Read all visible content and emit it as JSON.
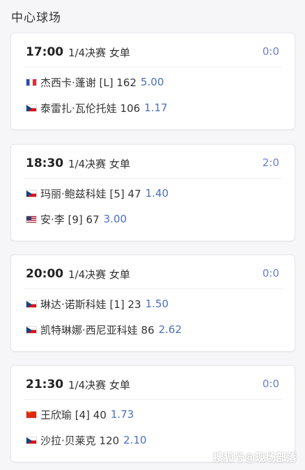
{
  "court_title": "中心球场",
  "matches": [
    {
      "time": "17:00",
      "round": "1/4决赛 女单",
      "score": "0:0",
      "players": [
        {
          "flag": "flag-fr",
          "name": "杰西卡·蓬谢 [L] 162",
          "odds": "5.00"
        },
        {
          "flag": "flag-cz",
          "name": "泰雷扎·瓦伦托娃 106",
          "odds": "1.17"
        }
      ]
    },
    {
      "time": "18:30",
      "round": "1/4决赛 女单",
      "score": "2:0",
      "players": [
        {
          "flag": "flag-cz",
          "name": "玛丽·鲍兹科娃 [5] 47",
          "odds": "1.40"
        },
        {
          "flag": "flag-us",
          "name": "安·李 [9] 67",
          "odds": "3.00"
        }
      ]
    },
    {
      "time": "20:00",
      "round": "1/4决赛 女单",
      "score": "0:0",
      "players": [
        {
          "flag": "flag-cz",
          "name": "琳达·诺斯科娃 [1] 23",
          "odds": "1.50"
        },
        {
          "flag": "flag-cz",
          "name": "凯特琳娜·西尼亚科娃 86",
          "odds": "2.62"
        }
      ]
    },
    {
      "time": "21:30",
      "round": "1/4决赛 女单",
      "score": "0:0",
      "players": [
        {
          "flag": "flag-cn",
          "name": "王欣瑜 [4] 40",
          "odds": "1.73"
        },
        {
          "flag": "flag-cz",
          "name": "沙拉·贝莱克 120",
          "odds": "2.10"
        }
      ]
    }
  ],
  "watermark": "搜狐号@现场部落"
}
